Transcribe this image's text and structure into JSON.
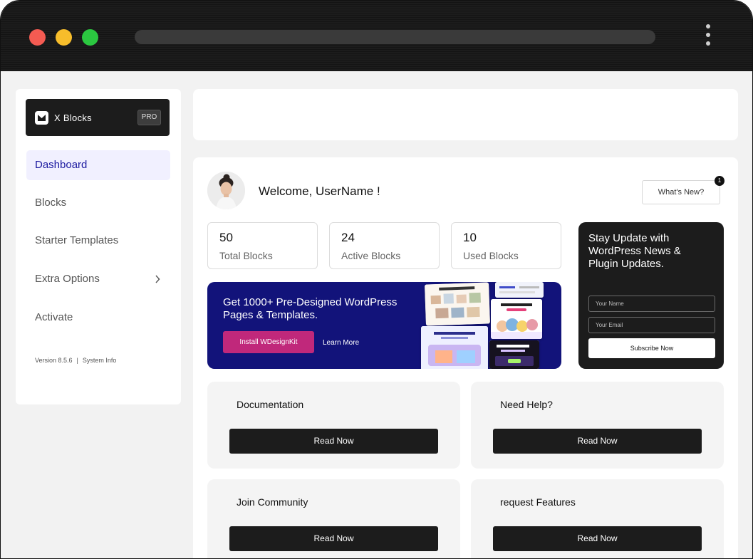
{
  "sidebar": {
    "brand_name": "X Blocks",
    "pro_badge": "PRO",
    "items": [
      {
        "label": "Dashboard",
        "active": true
      },
      {
        "label": "Blocks",
        "active": false
      },
      {
        "label": "Starter Templates",
        "active": false
      },
      {
        "label": "Extra Options",
        "active": false,
        "has_submenu": true
      },
      {
        "label": "Activate",
        "active": false
      }
    ],
    "version": "Version 8.5.6",
    "separator": "|",
    "system_info": "System Info"
  },
  "header": {
    "welcome": "Welcome, UserName !",
    "whats_new": "What's New?",
    "notification_count": "1"
  },
  "stats": [
    {
      "value": "50",
      "label": "Total Blocks"
    },
    {
      "value": "24",
      "label": "Active Blocks"
    },
    {
      "value": "10",
      "label": "Used Blocks"
    }
  ],
  "promo": {
    "title": "Get 1000+ Pre-Designed WordPress Pages & Templates.",
    "install_label": "Install WDesignKit",
    "learn_more_label": "Learn More",
    "accent_color": "#c0287b",
    "background_color": "#12137a"
  },
  "newsletter": {
    "title": "Stay Update with WordPress News & Plugin Updates.",
    "name_placeholder": "Your Name",
    "email_placeholder": "Your Email",
    "subscribe_label": "Subscribe Now"
  },
  "cards": [
    {
      "title": "Documentation",
      "button": "Read Now"
    },
    {
      "title": "Need Help?",
      "button": "Read Now"
    },
    {
      "title": "Join Community",
      "button": "Read Now"
    },
    {
      "title": "request Features",
      "button": "Read Now"
    }
  ],
  "icons": {
    "brand": "x-blocks-logo-icon",
    "submenu": "chevron-right-icon",
    "menu": "kebab-menu-icon"
  }
}
